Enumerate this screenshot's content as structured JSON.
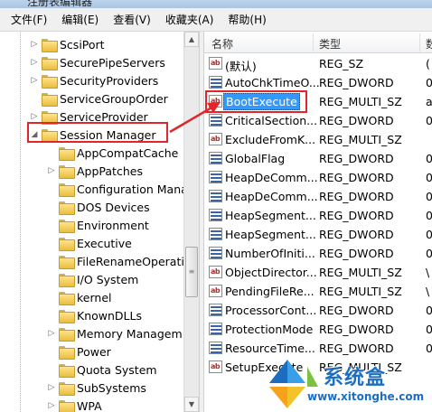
{
  "window": {
    "title": "注册表编辑器"
  },
  "menu": [
    "文件(F)",
    "编辑(E)",
    "查看(V)",
    "收藏夹(A)",
    "帮助(H)"
  ],
  "tree": {
    "items": [
      {
        "label": "ScsiPort",
        "arrow": "▷",
        "level": 0,
        "selected": false
      },
      {
        "label": "SecurePipeServers",
        "arrow": "▷",
        "level": 0,
        "selected": false
      },
      {
        "label": "SecurityProviders",
        "arrow": "▷",
        "level": 0,
        "selected": false
      },
      {
        "label": "ServiceGroupOrder",
        "arrow": "",
        "level": 0,
        "selected": false
      },
      {
        "label": "ServiceProvider",
        "arrow": "▷",
        "level": 0,
        "selected": false
      },
      {
        "label": "Session Manager",
        "arrow": "◢",
        "level": 0,
        "selected": true
      },
      {
        "label": "AppCompatCache",
        "arrow": "",
        "level": 1,
        "selected": false
      },
      {
        "label": "AppPatches",
        "arrow": "▷",
        "level": 1,
        "selected": false
      },
      {
        "label": "Configuration Mana",
        "arrow": "",
        "level": 1,
        "selected": false
      },
      {
        "label": "DOS Devices",
        "arrow": "",
        "level": 1,
        "selected": false
      },
      {
        "label": "Environment",
        "arrow": "",
        "level": 1,
        "selected": false
      },
      {
        "label": "Executive",
        "arrow": "",
        "level": 1,
        "selected": false
      },
      {
        "label": "FileRenameOperatio",
        "arrow": "",
        "level": 1,
        "selected": false
      },
      {
        "label": "I/O System",
        "arrow": "",
        "level": 1,
        "selected": false
      },
      {
        "label": "kernel",
        "arrow": "",
        "level": 1,
        "selected": false
      },
      {
        "label": "KnownDLLs",
        "arrow": "",
        "level": 1,
        "selected": false
      },
      {
        "label": "Memory Managem",
        "arrow": "▷",
        "level": 1,
        "selected": false
      },
      {
        "label": "Power",
        "arrow": "",
        "level": 1,
        "selected": false
      },
      {
        "label": "Quota System",
        "arrow": "",
        "level": 1,
        "selected": false
      },
      {
        "label": "SubSystems",
        "arrow": "▷",
        "level": 1,
        "selected": false
      },
      {
        "label": "WPA",
        "arrow": "▷",
        "level": 1,
        "selected": false
      }
    ]
  },
  "list": {
    "columns": {
      "name": "名称",
      "type": "类型",
      "data": "数"
    },
    "rows": [
      {
        "icon": "ab",
        "name": "(默认)",
        "type": "REG_SZ",
        "data": "(",
        "selected": false
      },
      {
        "icon": "bin",
        "name": "AutoChkTimeO...",
        "type": "REG_DWORD",
        "data": "0",
        "selected": false
      },
      {
        "icon": "ab",
        "name": "BootExecute",
        "type": "REG_MULTI_SZ",
        "data": "a",
        "selected": true
      },
      {
        "icon": "bin",
        "name": "CriticalSection...",
        "type": "REG_DWORD",
        "data": "0",
        "selected": false
      },
      {
        "icon": "ab",
        "name": "ExcludeFromK...",
        "type": "REG_MULTI_SZ",
        "data": "",
        "selected": false
      },
      {
        "icon": "bin",
        "name": "GlobalFlag",
        "type": "REG_DWORD",
        "data": "0",
        "selected": false
      },
      {
        "icon": "bin",
        "name": "HeapDeComm...",
        "type": "REG_DWORD",
        "data": "0",
        "selected": false
      },
      {
        "icon": "bin",
        "name": "HeapDeComm...",
        "type": "REG_DWORD",
        "data": "0",
        "selected": false
      },
      {
        "icon": "bin",
        "name": "HeapSegment...",
        "type": "REG_DWORD",
        "data": "0",
        "selected": false
      },
      {
        "icon": "bin",
        "name": "HeapSegment...",
        "type": "REG_DWORD",
        "data": "0",
        "selected": false
      },
      {
        "icon": "bin",
        "name": "NumberOfIniti...",
        "type": "REG_DWORD",
        "data": "0",
        "selected": false
      },
      {
        "icon": "ab",
        "name": "ObjectDirector...",
        "type": "REG_MULTI_SZ",
        "data": "\\",
        "selected": false
      },
      {
        "icon": "ab",
        "name": "PendingFileRe...",
        "type": "REG_MULTI_SZ",
        "data": "\\",
        "selected": false
      },
      {
        "icon": "bin",
        "name": "ProcessorCont...",
        "type": "REG_DWORD",
        "data": "0",
        "selected": false
      },
      {
        "icon": "bin",
        "name": "ProtectionMode",
        "type": "REG_DWORD",
        "data": "0",
        "selected": false
      },
      {
        "icon": "bin",
        "name": "ResourceTime...",
        "type": "REG_DWORD",
        "data": "0",
        "selected": false
      },
      {
        "icon": "ab",
        "name": "SetupExecute",
        "type": "REG_MULTI_SZ",
        "data": "",
        "selected": false
      }
    ]
  },
  "watermark": {
    "main": "系统盒",
    "url": "www.xitonghe.com"
  },
  "colors": {
    "accent": "#e0262a",
    "selection": "#3399ff",
    "watermark": "#1b6ec2"
  }
}
